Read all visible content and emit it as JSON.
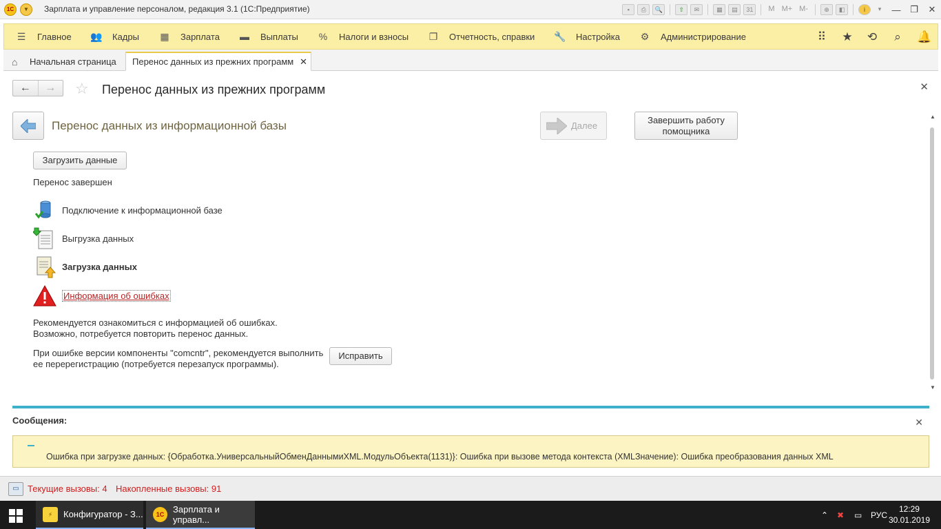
{
  "window": {
    "title": "Зарплата и управление персоналом, редакция 3.1  (1С:Предприятие)",
    "logo": "1С",
    "toolbar_labels": {
      "m": "M",
      "mplus": "M+",
      "mminus": "M-"
    }
  },
  "main_menu": {
    "items": [
      {
        "label": "Главное",
        "icon": "hamburger-icon"
      },
      {
        "label": "Кадры",
        "icon": "people-icon"
      },
      {
        "label": "Зарплата",
        "icon": "calculator-icon"
      },
      {
        "label": "Выплаты",
        "icon": "wallet-icon"
      },
      {
        "label": "Налоги и взносы",
        "icon": "percent-icon"
      },
      {
        "label": "Отчетность, справки",
        "icon": "documents-icon"
      },
      {
        "label": "Настройка",
        "icon": "wrench-icon"
      },
      {
        "label": "Администрирование",
        "icon": "gear-icon"
      }
    ]
  },
  "tabs": {
    "home": "Начальная страница",
    "active": "Перенос данных из прежних программ"
  },
  "form": {
    "title": "Перенос данных из прежних программ",
    "subtitle": "Перенос данных из информационной базы",
    "next_label": "Далее",
    "finish_label_line1": "Завершить работу",
    "finish_label_line2": "помощника",
    "load_button": "Загрузить данные",
    "status": "Перенос завершен",
    "steps": [
      {
        "label": "Подключение к информационной базе",
        "icon": "database-check-icon"
      },
      {
        "label": "Выгрузка данных",
        "icon": "export-document-icon"
      },
      {
        "label": "Загрузка данных",
        "icon": "import-document-icon"
      },
      {
        "label": "Информация об ошибках",
        "icon": "warning-icon"
      }
    ],
    "note1_line1": "Рекомендуется ознакомиться с информацией об ошибках.",
    "note1_line2": "Возможно, потребуется повторить перенос данных.",
    "note2_line1": "При ошибке версии компоненты \"comcntr\", рекомендуется выполнить",
    "note2_line2": "ее перерегистрацию (потребуется перезапуск программы).",
    "fix_button": "Исправить"
  },
  "messages": {
    "title": "Сообщения:",
    "text": "Ошибка при загрузке данных: {Обработка.УниверсальныйОбменДаннымиXML.МодульОбъекта(1131)}: Ошибка при вызове метода контекста (XMLЗначение): Ошибка преобразования данных XML"
  },
  "statusbar": {
    "current_calls": "Текущие вызовы: 4",
    "accumulated_calls": "Накопленные вызовы: 91"
  },
  "taskbar": {
    "tasks": [
      {
        "label": "Конфигуратор - З..."
      },
      {
        "label": "Зарплата и управл..."
      }
    ],
    "language": "РУС",
    "time": "12:29",
    "date": "30.01.2019"
  },
  "colors": {
    "menu_bg": "#fbeea5",
    "accent_blue": "#3fb0cc",
    "error_red": "#d01d1d",
    "message_bg": "#fcf4c3"
  }
}
